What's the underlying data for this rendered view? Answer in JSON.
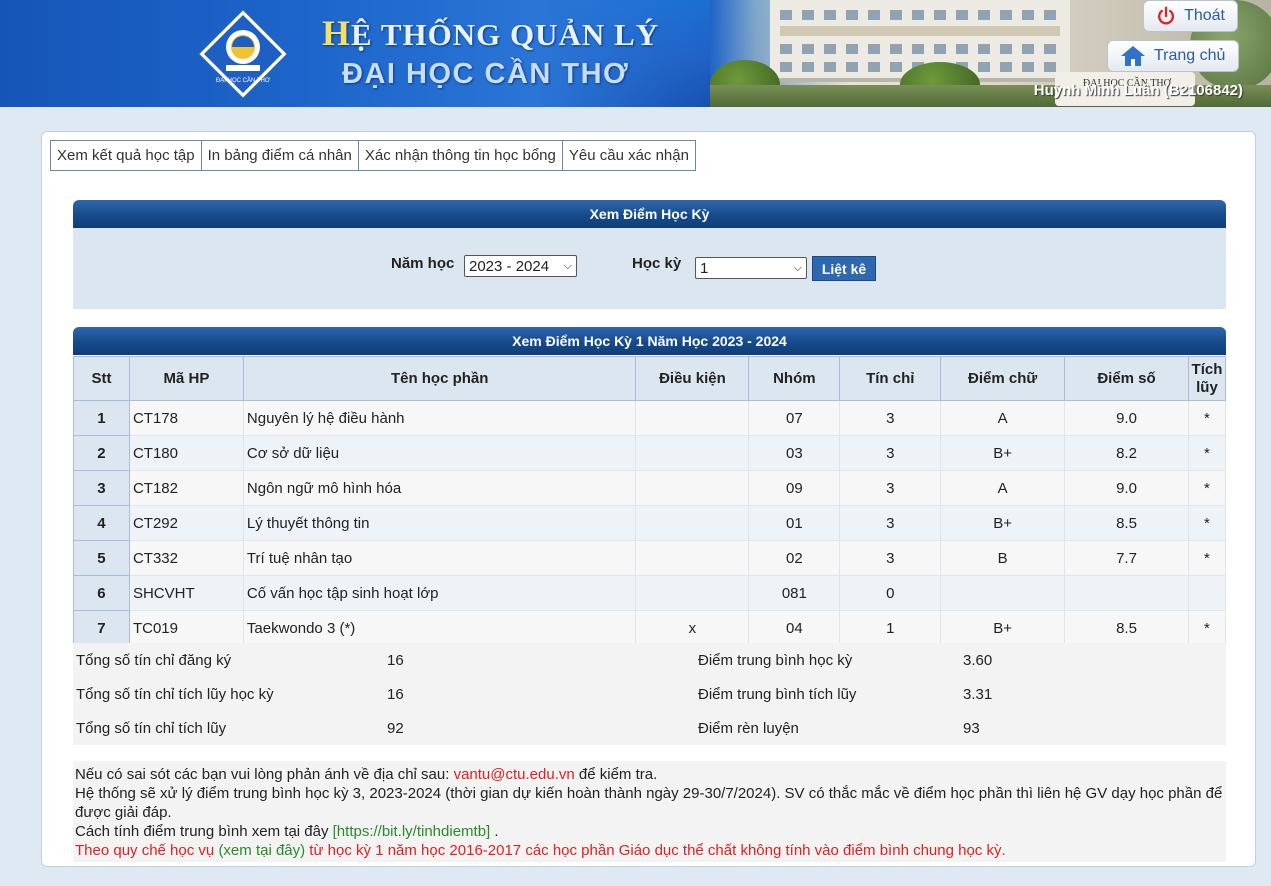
{
  "header": {
    "title_line1_first": "H",
    "title_line1_rest": "Ệ THỐNG QUẢN LÝ",
    "title_line2": "ĐẠI HỌC CẦN THƠ",
    "logo_text": "ĐẠI HỌC CẦN THƠ",
    "photo_stone_text": "ĐẠI HỌC CẦN THƠ",
    "logout_label": "Thoát",
    "home_label": "Trang chủ",
    "user": "Huỳnh Minh Luân (B2106842)"
  },
  "tabs": [
    {
      "label": "Xem kết quả học tập"
    },
    {
      "label": "In bảng điểm cá nhân"
    },
    {
      "label": "Xác nhận thông tin học bổng"
    },
    {
      "label": "Yêu cầu xác nhận"
    }
  ],
  "filter": {
    "title": "Xem Điểm Học Kỳ",
    "year_label": "Năm học",
    "year_value": "2023 - 2024",
    "term_label": "Học kỳ",
    "term_value": "1",
    "submit_label": "Liệt kê"
  },
  "grades": {
    "title": "Xem Điểm Học Kỳ 1 Năm Học 2023 - 2024",
    "columns": [
      "Stt",
      "Mã HP",
      "Tên học phần",
      "Điều kiện",
      "Nhóm",
      "Tín chỉ",
      "Điểm chữ",
      "Điểm số",
      "Tích lũy"
    ],
    "rows": [
      {
        "stt": "1",
        "code": "CT178",
        "name": "Nguyên lý hệ điều hành",
        "condition": "",
        "group": "07",
        "credits": "3",
        "letter": "A",
        "score": "9.0",
        "accum": "*"
      },
      {
        "stt": "2",
        "code": "CT180",
        "name": "Cơ sở dữ liệu",
        "condition": "",
        "group": "03",
        "credits": "3",
        "letter": "B+",
        "score": "8.2",
        "accum": "*"
      },
      {
        "stt": "3",
        "code": "CT182",
        "name": "Ngôn ngữ mô hình hóa",
        "condition": "",
        "group": "09",
        "credits": "3",
        "letter": "A",
        "score": "9.0",
        "accum": "*"
      },
      {
        "stt": "4",
        "code": "CT292",
        "name": "Lý thuyết thông tin",
        "condition": "",
        "group": "01",
        "credits": "3",
        "letter": "B+",
        "score": "8.5",
        "accum": "*"
      },
      {
        "stt": "5",
        "code": "CT332",
        "name": "Trí tuệ nhân tạo",
        "condition": "",
        "group": "02",
        "credits": "3",
        "letter": "B",
        "score": "7.7",
        "accum": "*"
      },
      {
        "stt": "6",
        "code": "SHCVHT",
        "name": "Cố vấn học tập sinh hoạt lớp",
        "condition": "",
        "group": "081",
        "credits": "0",
        "letter": "",
        "score": "",
        "accum": ""
      },
      {
        "stt": "7",
        "code": "TC019",
        "name": "Taekwondo 3 (*)",
        "condition": "x",
        "group": "04",
        "credits": "1",
        "letter": "B+",
        "score": "8.5",
        "accum": "*"
      }
    ]
  },
  "summary": {
    "registered_label": "Tổng số tín chỉ đăng ký",
    "registered_value": "16",
    "term_accum_label": "Tổng số tín chỉ tích lũy học kỳ",
    "term_accum_value": "16",
    "total_accum_label": "Tổng số tín chỉ tích lũy",
    "total_accum_value": "92",
    "gpa_term_label": "Điểm trung bình học kỳ",
    "gpa_term_value": "3.60",
    "gpa_accum_label": "Điểm trung bình tích lũy",
    "gpa_accum_value": "3.31",
    "conduct_label": "Điểm rèn luyện",
    "conduct_value": "93"
  },
  "notes": {
    "line1_pre": "Nếu có sai sót các bạn vui lòng phản ánh về địa chỉ sau: ",
    "line1_email": "vantu@ctu.edu.vn",
    "line1_post": " để kiểm tra.",
    "line2": "Hệ thống sẽ xử lý điểm trung bình học kỳ 3, 2023-2024 (thời gian dự kiến hoàn thành ngày 29-30/7/2024). SV có thắc mắc về điểm học phần thì liên hệ GV dạy học phần để được giải đáp.",
    "line3_pre": "Cách tính điểm trung bình xem tại đây ",
    "line3_link": "[https://bit.ly/tinhdiemtb]",
    "line3_post": " .",
    "line4_pre": "Theo quy chế học vụ ",
    "line4_link": "(xem tại đây)",
    "line4_post": " từ học kỳ 1 năm học 2016-2017 các học phần Giáo dục thể chất không tính vào điểm bình chung học kỳ."
  },
  "colors": {
    "header_blue": "#1a6fd0",
    "box_header": "#174a8b",
    "email_red": "#e02020",
    "link_green": "#2a8a2a"
  }
}
